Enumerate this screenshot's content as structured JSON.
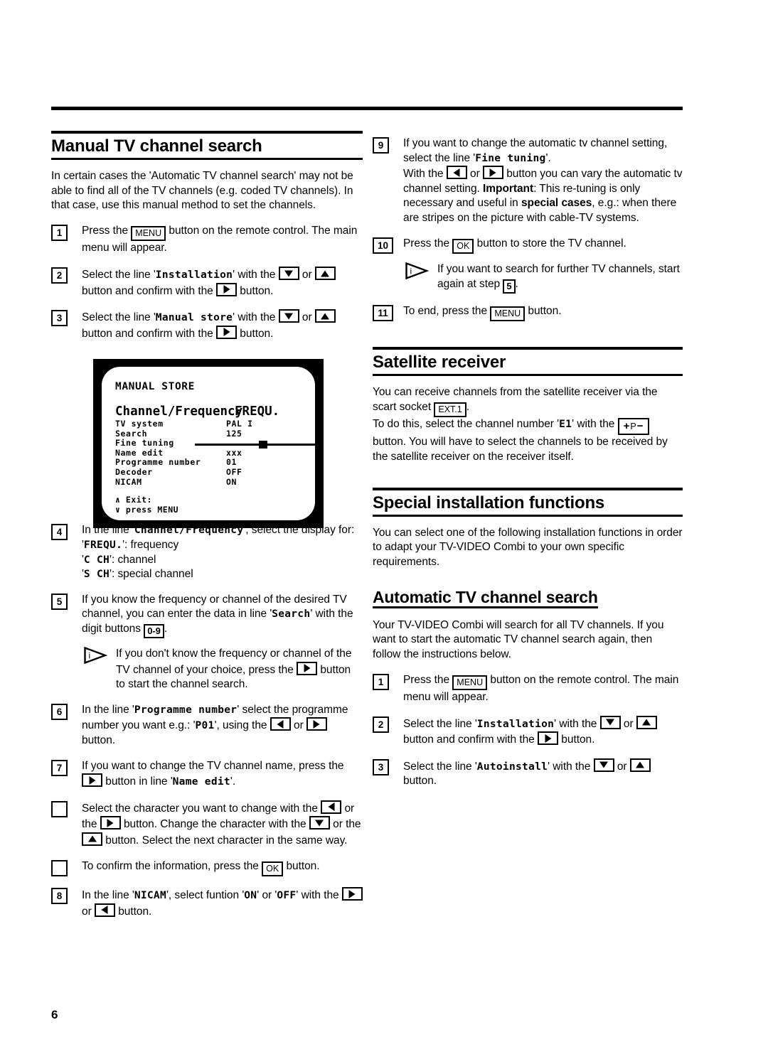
{
  "page": {
    "number": "6"
  },
  "left_column": {
    "heading": "Manual TV channel search",
    "intro": "In certain cases the 'Automatic TV channel search' may not be able to find all of the TV channels (e.g. coded TV channels). In that case, use this manual method to set the channels.",
    "steps": {
      "s1": {
        "num": "1",
        "t1": "Press the",
        "key": "MENU",
        "t2": "button on the remote control. The main menu will appear."
      },
      "s2": {
        "num": "2",
        "t1": "Select the line '",
        "term": "Installation",
        "t2": "' with the",
        "key1": "down-arrow",
        "or": "or",
        "key2": "up-arrow",
        "t3": "button and confirm with the",
        "key3": "right-arrow",
        "t4": "button."
      },
      "s3": {
        "num": "3",
        "t1": "Select the line '",
        "term": "Manual store",
        "t2": "' with the",
        "key1": "down-arrow",
        "or": "or",
        "key2": "up-arrow",
        "t3": "button and confirm with the",
        "key3": "right-arrow",
        "t4": "button."
      },
      "s4": {
        "num": "4",
        "t1": "In the line '",
        "term": "Channel/Frequency",
        "t2": "', select the display for:",
        "options": [
          {
            "code": "FREQU.",
            "label": ": frequency"
          },
          {
            "code": "C CH",
            "label": ": channel"
          },
          {
            "code": "S CH",
            "label": ": special channel"
          }
        ]
      },
      "s5": {
        "num": "5",
        "t1": "If you know the frequency or channel of the desired TV channel, you can enter the data in line '",
        "term": "Search",
        "t2": "' with the digit buttons",
        "key": "0-9",
        "t3": ".",
        "note": {
          "t1": "If you don't know the frequency or channel of the TV channel of your choice, press the",
          "key": "right-arrow",
          "t2": "button to start the channel search."
        }
      },
      "s6": {
        "num": "6",
        "t1": "In the line '",
        "term": "Programme number",
        "t2": "' select the programme number you want e.g.: '",
        "value": "P01",
        "t3": "', using the",
        "key1": "left-arrow",
        "or": "or",
        "key2": "right-arrow",
        "t4": "button."
      },
      "s7": {
        "num": "7",
        "t1": "If you want to change the TV channel name, press the",
        "key": "right-arrow",
        "t2": "button in line '",
        "term": "Name edit",
        "t3": "'."
      },
      "s7a": {
        "num": "",
        "t1": "Select the character you want to change with the",
        "key1": "left-arrow",
        "or1": "or the",
        "key2": "right-arrow",
        "t2": "button. Change the character with the",
        "key3": "down-arrow",
        "or2": "or the",
        "key4": "up-arrow",
        "t3": "button. Select the next character in the same way."
      },
      "s7b": {
        "num": "",
        "t1": "To confirm the information, press the",
        "key": "OK",
        "t2": "button."
      },
      "s8": {
        "num": "8",
        "t1": "In the line '",
        "term": "NICAM",
        "t2": "', select funtion '",
        "on": "ON",
        "t3": "' or '",
        "off": "OFF",
        "t4": "' with the",
        "key1": "right-arrow",
        "or": "or",
        "key2": "left-arrow",
        "t5": "button."
      }
    }
  },
  "tv_screen": {
    "title": "MANUAL STORE",
    "main_row": {
      "label": "Channel/Frequency",
      "value": "FREQU."
    },
    "rows": [
      {
        "label": "TV system",
        "value": "PAL I"
      },
      {
        "label": "Search",
        "value": "125"
      },
      {
        "label": "Fine tuning",
        "value": "",
        "slider": true
      },
      {
        "label": "Name edit",
        "value": "xxx"
      },
      {
        "label": "Programme number",
        "value": "01"
      },
      {
        "label": "Decoder",
        "value": "OFF"
      },
      {
        "label": "NICAM",
        "value": "ON"
      }
    ],
    "footer_line1": "∧ Exit:",
    "footer_line2": "∨ press MENU"
  },
  "right_column": {
    "steps": {
      "s9": {
        "num": "9",
        "t1": "If you want to change the automatic tv channel setting, select the line '",
        "term": "Fine tuning",
        "t2": "'.",
        "t3": "With the",
        "key1": "left-arrow",
        "or": "or",
        "key2": "right-arrow",
        "t4": "button you can vary the automatic tv channel setting.",
        "important": "Important",
        "t5": ": This re-tuning is only necessary and useful in",
        "special": "special cases",
        "t6": ", e.g.: when there are stripes on the picture with cable-TV systems."
      },
      "s10": {
        "num": "10",
        "t1": "Press the",
        "key": "OK",
        "t2": "button to store the TV channel.",
        "note": {
          "t1": "If you want to search for further TV channels, start again at step",
          "stepref": "5",
          "t2": "."
        }
      },
      "s11": {
        "num": "11",
        "t1": "To end, press the",
        "key": "MENU",
        "t2": "button."
      }
    },
    "satellite": {
      "heading": "Satellite receiver",
      "p1a": "You can receive channels from the satellite receiver via the scart socket",
      "key_ext": "EXT.1",
      "p1b": ".",
      "p2a": "To do this, select the channel number '",
      "chan": "E1",
      "p2b": "' with the",
      "key_pm": "+P−",
      "p2c": "button. You will have to select the channels to be received by the satellite receiver on the receiver itself."
    },
    "special_functions": {
      "heading": "Special installation functions",
      "body": "You can select one of the following installation functions in order to adapt your TV-VIDEO Combi to your own specific requirements."
    },
    "auto_search": {
      "heading": "Automatic TV channel search",
      "body": "Your TV-VIDEO Combi will search for all TV channels. If you want to start the automatic TV channel search again, then follow the instructions below.",
      "steps": {
        "a1": {
          "num": "1",
          "t1": "Press the",
          "key": "MENU",
          "t2": "button on the remote control. The main menu will appear."
        },
        "a2": {
          "num": "2",
          "t1": "Select the line '",
          "term": "Installation",
          "t2": "' with the",
          "key1": "down-arrow",
          "or": "or",
          "key2": "up-arrow",
          "t3": "button and confirm with the",
          "key3": "right-arrow",
          "t4": "button."
        },
        "a3": {
          "num": "3",
          "t1": "Select the line '",
          "term": "Autoinstall",
          "t2": "' with the",
          "key1": "down-arrow",
          "or": "or",
          "key2": "up-arrow",
          "t3": "button."
        }
      }
    }
  }
}
